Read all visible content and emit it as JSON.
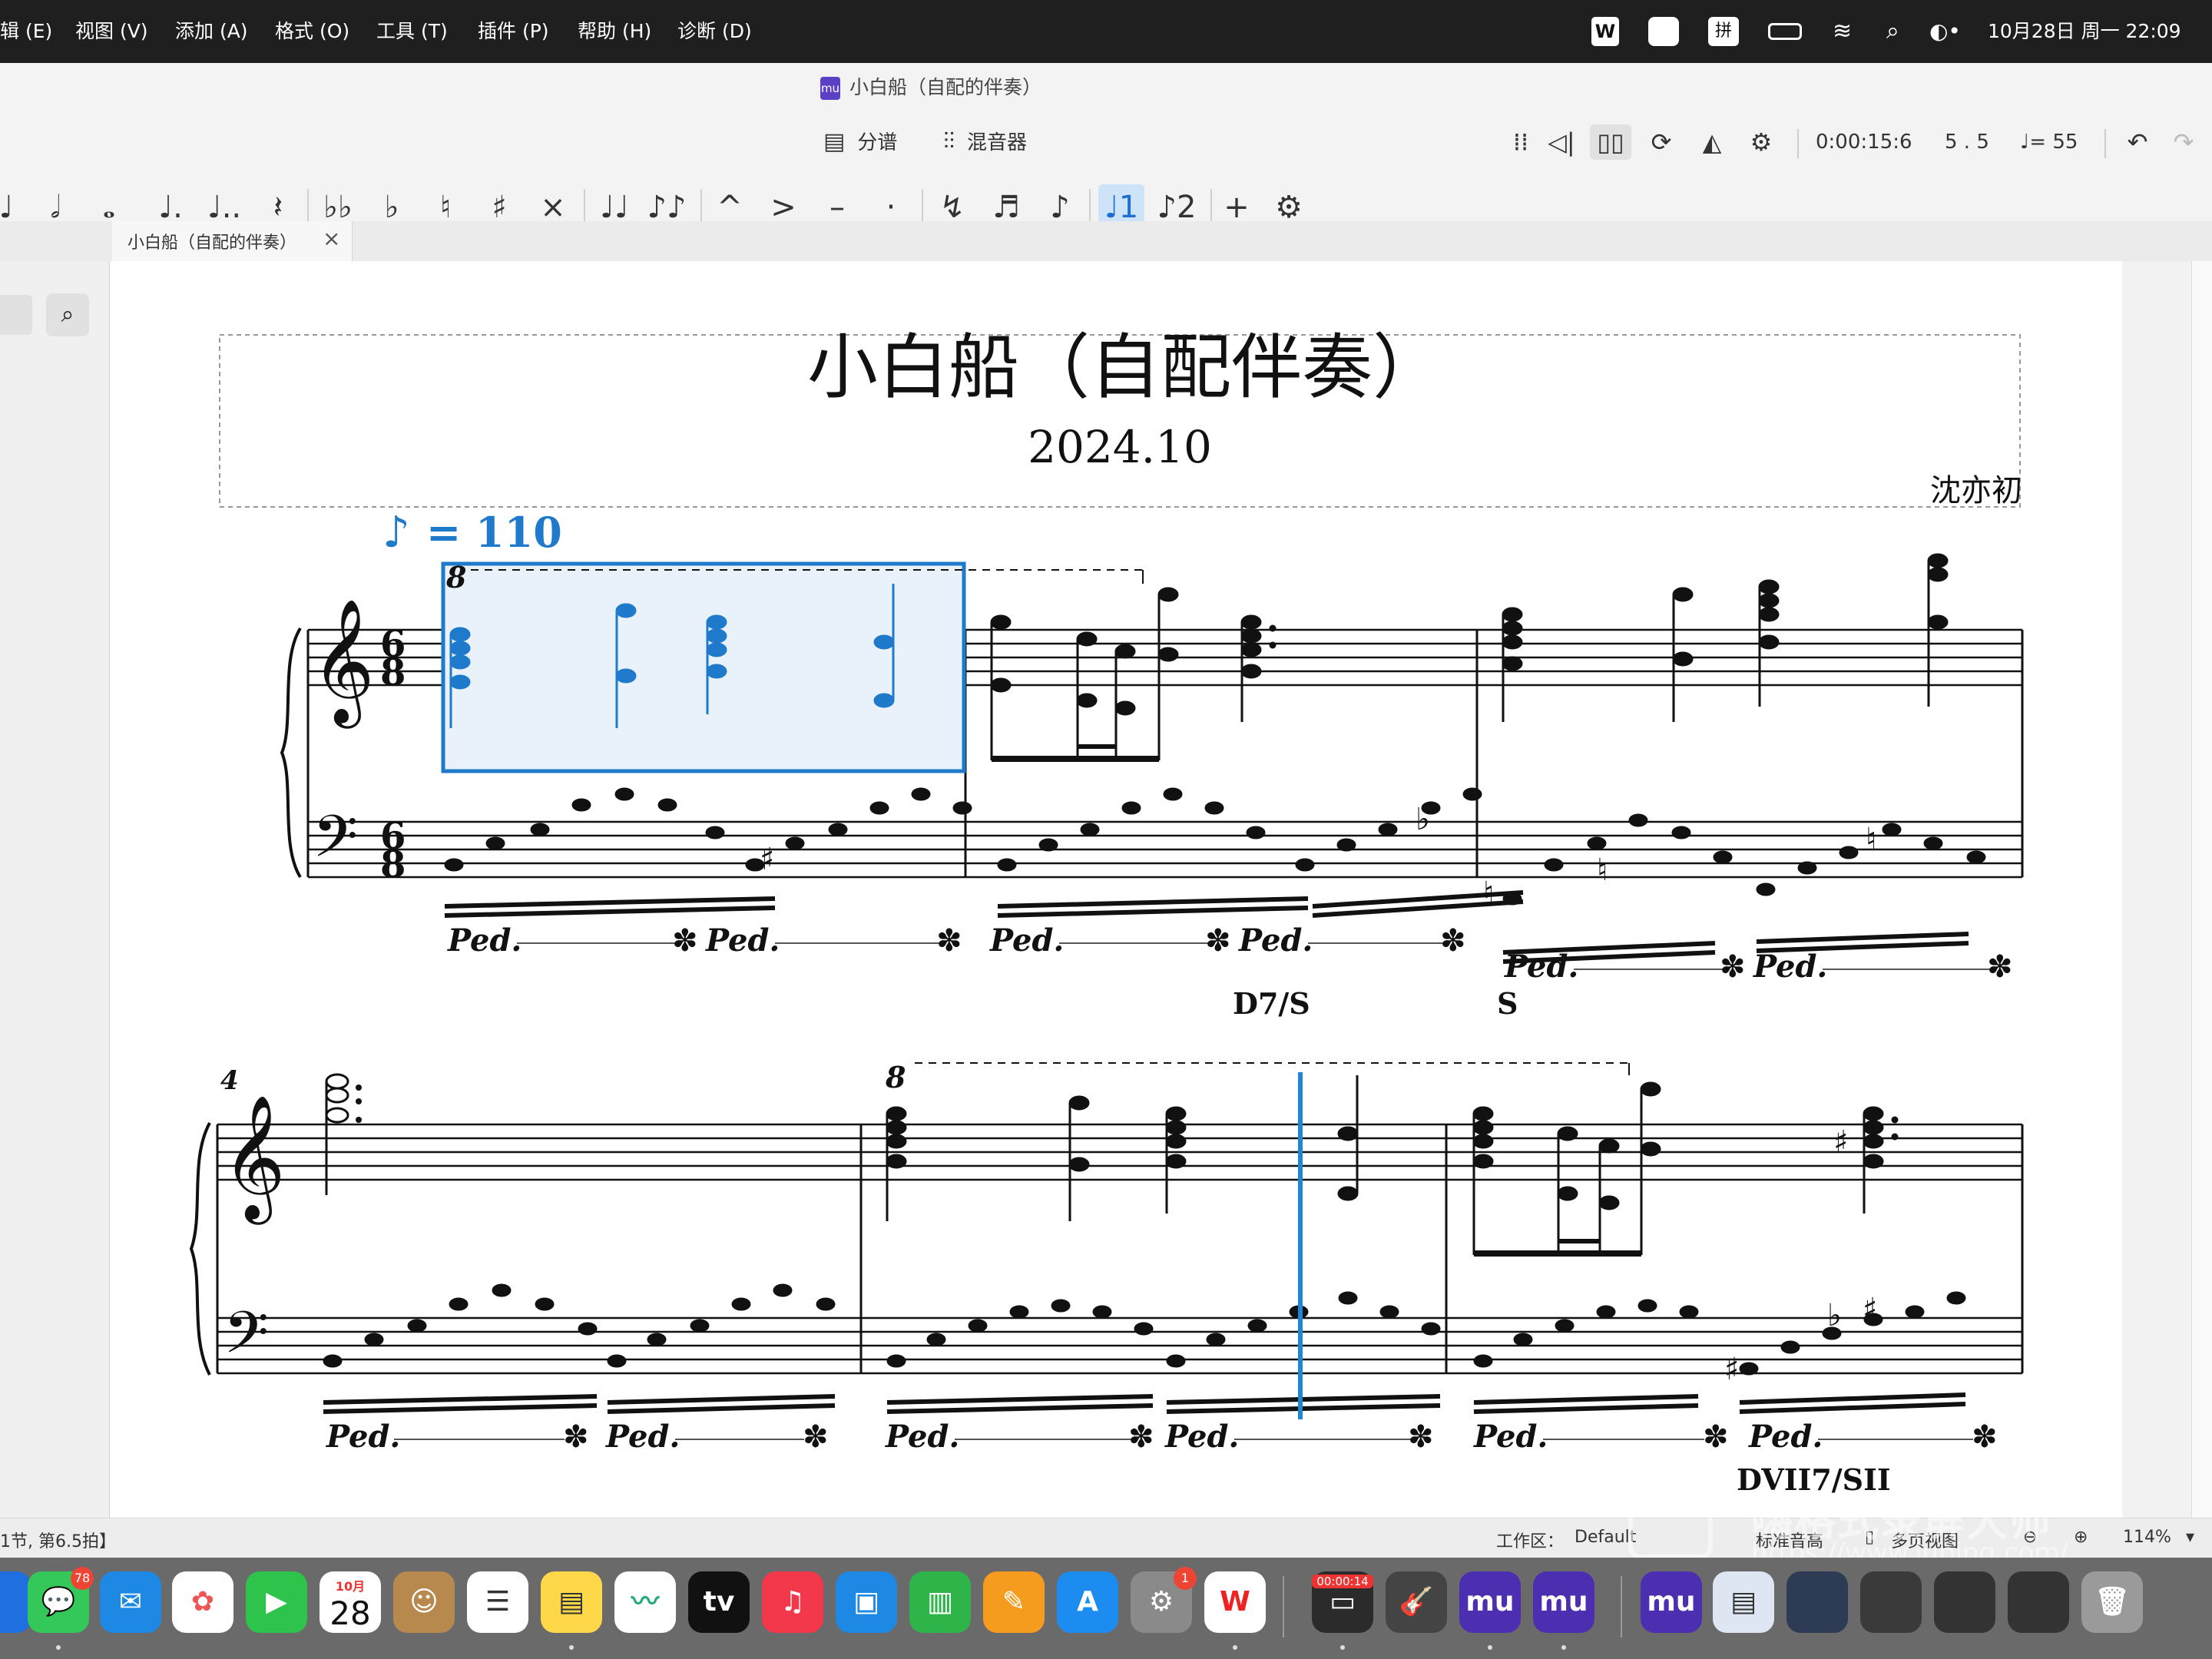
{
  "menubar": {
    "menus": [
      "辑 (E)",
      "视图 (V)",
      "添加 (A)",
      "格式 (O)",
      "工具 (T)",
      "插件 (P)",
      "帮助 (H)",
      "诊断 (D)"
    ],
    "input_method": "拼",
    "datetime": "10月28日 周一  22:09"
  },
  "window": {
    "title": "小白船（自配的伴奏）",
    "doc_icon": "mu"
  },
  "toolbar": {
    "parts_label": "分谱",
    "mixer_label": "混音器",
    "time": "0:00:15:6",
    "position": "5 . 5",
    "tempo": "= 55"
  },
  "tab": {
    "label": "小白船（自配的伴奏）",
    "close": "×"
  },
  "score": {
    "title": "小白船（自配伴奏）",
    "subtitle": "2024.10",
    "composer": "沈亦初",
    "tempo_mark": "= 110",
    "ottava_1": "8",
    "ottava_2": "8",
    "measure_number_2": "4",
    "pedal": "Ped.",
    "harmony_1": "D7/S",
    "harmony_2": "S",
    "harmony_3": "DVII7/SII",
    "time_sig_top": "6",
    "time_sig_bottom": "8"
  },
  "statusbar": {
    "position_text": "1节, 第6.5拍】",
    "workspace_label": "工作区：",
    "workspace_value": "Default",
    "pitch_label": "标准音高",
    "view_label": "多页视图",
    "zoom": "114%"
  },
  "watermark": {
    "title": "嗨格式录屏大师",
    "url": "https://www.luping.com/"
  },
  "dock": {
    "messages_badge": "78",
    "calendar_month": "10月",
    "calendar_day": "28",
    "settings_badge": "1",
    "recording_time": "00:00:14",
    "tv_label": "tv"
  },
  "colors": {
    "selection": "#1f7acb",
    "selection_fill": "#e9f2fb",
    "playhead": "#1f86d6"
  }
}
